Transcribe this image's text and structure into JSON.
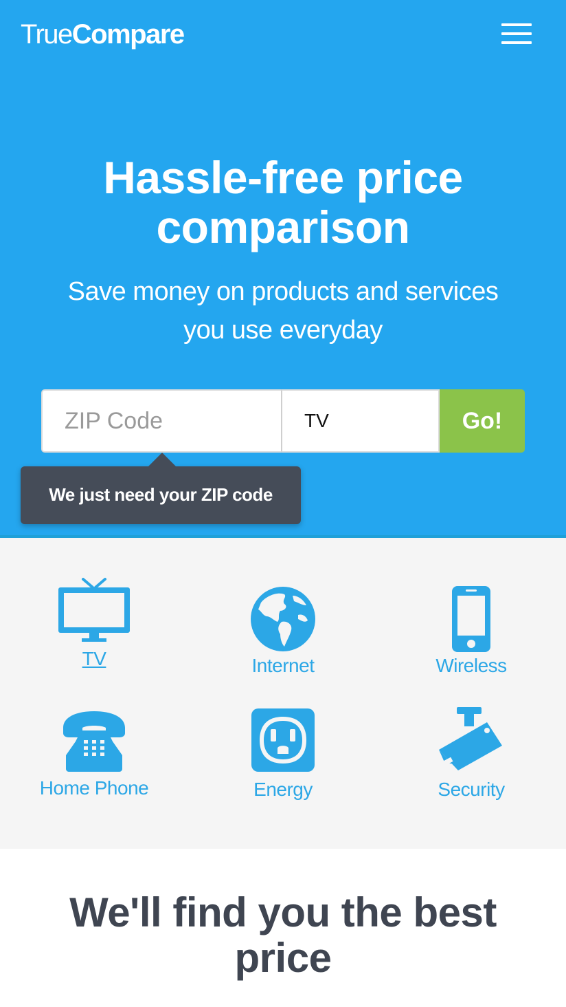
{
  "header": {
    "logo_light": "True",
    "logo_bold": "Compare",
    "menu_icon": "hamburger-menu-icon"
  },
  "hero": {
    "title_line1": "Hassle-free price",
    "title_line2": "comparison",
    "subtitle_line1": "Save money on products and services",
    "subtitle_line2": "you use everyday"
  },
  "search": {
    "zip_placeholder": "ZIP Code",
    "zip_value": "",
    "service_value": "TV",
    "go_label": "Go!"
  },
  "tooltip": {
    "text": "We just need your ZIP code"
  },
  "categories": [
    {
      "label": "TV",
      "icon": "tv-icon"
    },
    {
      "label": "Internet",
      "icon": "globe-icon"
    },
    {
      "label": "Wireless",
      "icon": "smartphone-icon"
    },
    {
      "label": "Home Phone",
      "icon": "telephone-icon"
    },
    {
      "label": "Energy",
      "icon": "power-outlet-icon"
    },
    {
      "label": "Security",
      "icon": "security-camera-icon"
    }
  ],
  "section": {
    "heading_line1": "We'll find you the best",
    "heading_line2": "price"
  },
  "colors": {
    "brand_blue": "#24a6ef",
    "go_green": "#8bc34a",
    "tooltip_bg": "#454c58",
    "icon_blue": "#2ca7e6",
    "heading_dark": "#3f4551"
  }
}
